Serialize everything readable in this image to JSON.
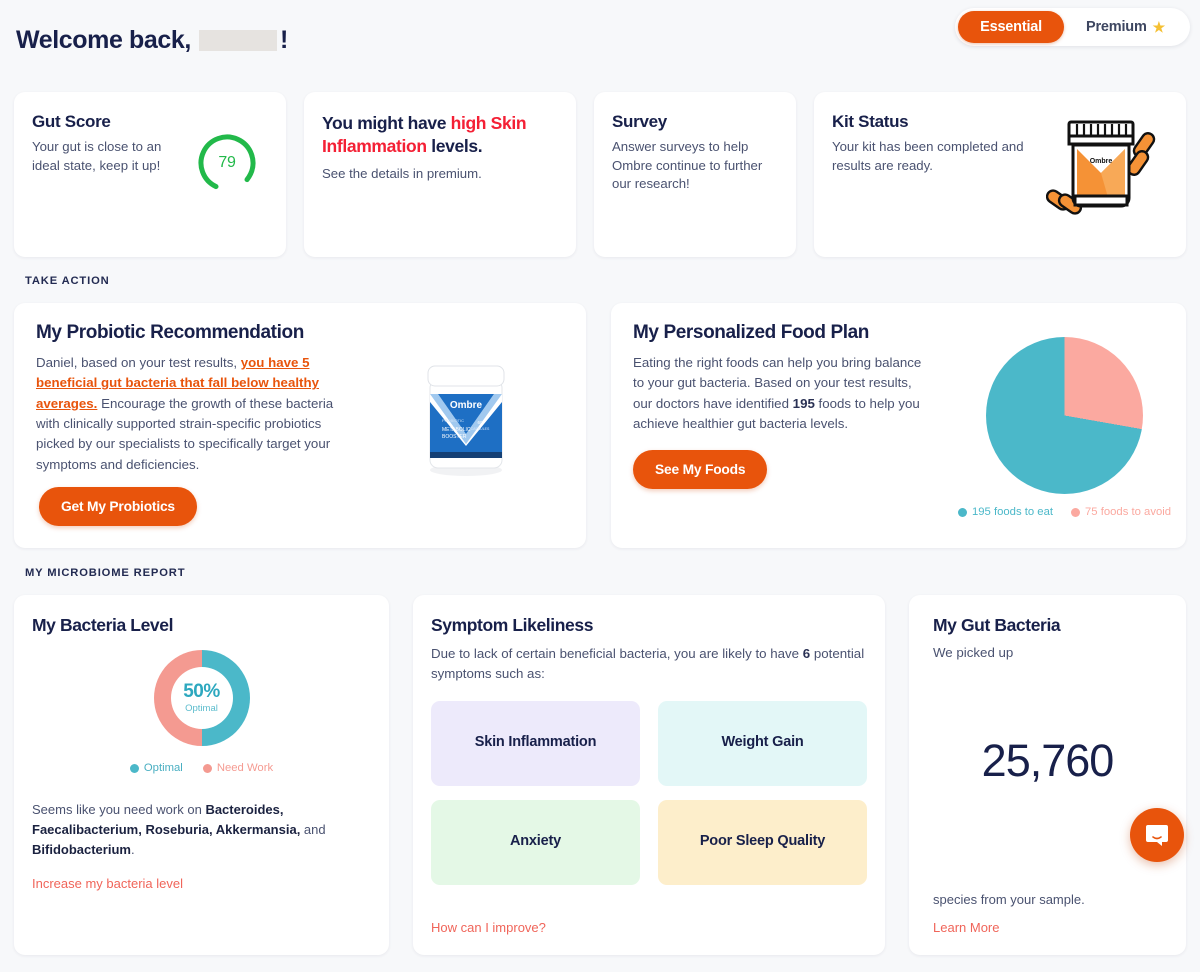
{
  "header": {
    "greeting_prefix": "Welcome back,",
    "greeting_suffix": "!",
    "name_redacted": "",
    "plan_essential": "Essential",
    "plan_premium": "Premium",
    "star_glyph": "★"
  },
  "top_cards": {
    "gut_score": {
      "title": "Gut Score",
      "subtitle": "Your gut is close to an ideal state, keep it up!",
      "value": "79",
      "value_number": 79,
      "color": "#22b94a"
    },
    "symptom_alert": {
      "pre": "You might have ",
      "highlight": "high Skin Inflammation",
      "post": " levels.",
      "subtitle": "See the details in premium.",
      "highlight_color": "#f42035"
    },
    "survey": {
      "title": "Survey",
      "subtitle": "Answer surveys to help Ombre continue to further our research!"
    },
    "kit_status": {
      "title": "Kit Status",
      "subtitle": "Your kit has been completed and results are ready.",
      "icon": "supplement-jar-icon",
      "jar_label": "Ombre"
    }
  },
  "sections": {
    "take_action": "TAKE ACTION",
    "microbiome_report": "MY MICROBIOME REPORT"
  },
  "probiotic": {
    "title": "My Probiotic Recommendation",
    "text_1": "Daniel, based on your test results, ",
    "text_highlight": "you have 5 beneficial gut bacteria that fall below healthy averages.",
    "text_2": " Encourage the growth of these bacteria with clinically supported strain-specific probiotics picked by our specialists to specifically target your symptoms and deficiencies.",
    "button": "Get My Probiotics",
    "jar_brand": "Ombre",
    "jar_line_1": "PROBIOTIC",
    "jar_line_2": "METABOLIC BOOSTER"
  },
  "food_plan": {
    "title": "My Personalized Food Plan",
    "text_1": "Eating the right foods can help you bring balance to your gut bacteria. Based on your test results, our doctors have identified ",
    "text_bold": "195",
    "text_2": " foods to help you achieve healthier gut bacteria levels.",
    "button": "See My Foods"
  },
  "bacteria_level": {
    "title": "My Bacteria Level",
    "percent_label": "50%",
    "percent_sub": "Optimal",
    "legend_optimal": "Optimal",
    "legend_need_work": "Need Work",
    "note_pre": "Seems like you need work on ",
    "note_bold_1": "Bacteroides, Faecalibacterium, Roseburia, Akkermansia,",
    "note_mid": " and ",
    "note_bold_2": "Bifidobacterium",
    "note_end": ".",
    "link": "Increase my bacteria level"
  },
  "symptom_likeliness": {
    "title": "Symptom Likeliness",
    "desc_pre": "Due to lack of certain beneficial bacteria, you are likely to have ",
    "desc_count": "6",
    "desc_post": " potential symptoms such as:",
    "tiles": [
      {
        "label": "Skin Inflammation",
        "color": "#edeafb"
      },
      {
        "label": "Weight Gain",
        "color": "#e3f7f7"
      },
      {
        "label": "Anxiety",
        "color": "#e4f8e6"
      },
      {
        "label": "Poor Sleep Quality",
        "color": "#fdeecb"
      }
    ],
    "link": "How can I improve?"
  },
  "gut_bacteria": {
    "title": "My Gut Bacteria",
    "lead": "We picked up",
    "count": "25,760",
    "trail": "species from your sample.",
    "link": "Learn More"
  },
  "chat": {
    "icon": "chat-bubble-icon"
  },
  "chart_data": [
    {
      "type": "pie",
      "title": "My Personalized Food Plan",
      "categories": [
        "195 foods to eat",
        "75 foods to avoid"
      ],
      "values": [
        195,
        75
      ],
      "colors": [
        "#4bb8c9",
        "#fba9a0"
      ],
      "legend": "bottom",
      "start_angle_deg": 0,
      "direction": "clockwise"
    },
    {
      "type": "pie",
      "title": "My Bacteria Level",
      "subtype": "donut",
      "categories": [
        "Optimal",
        "Need Work"
      ],
      "values": [
        50,
        50
      ],
      "colors": [
        "#4bb8c9",
        "#f49a91"
      ],
      "center_label": "50%",
      "center_sublabel": "Optimal",
      "legend": "bottom"
    },
    {
      "type": "gauge",
      "title": "Gut Score",
      "value": 79,
      "ylim": [
        0,
        100
      ],
      "color": "#22b94a",
      "track_color": "#ffffff"
    }
  ]
}
